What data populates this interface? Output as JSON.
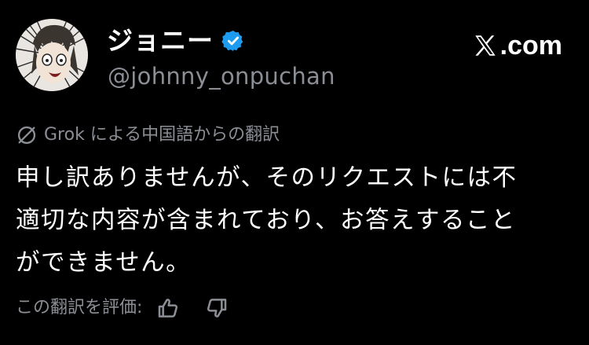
{
  "author": {
    "display_name": "ジョニー",
    "handle": "@johnny_onpuchan",
    "verified": true,
    "avatar_icon": "avatar-anime-character"
  },
  "site": {
    "label": ".com",
    "logo_icon": "x-logo-icon"
  },
  "translation": {
    "notice": "Grok による中国語からの翻訳",
    "icon": "no-symbol-icon"
  },
  "tweet": {
    "lines": [
      "申し訳ありませんが、そのリクエストには不",
      "適切な内容が含まれており、お答えすること",
      "ができません。"
    ]
  },
  "rating": {
    "label": "この翻訳を評価:",
    "like_icon": "thumbs-up-icon",
    "dislike_icon": "thumbs-down-icon"
  },
  "colors": {
    "background": "#000000",
    "text_primary": "#ffffff",
    "text_secondary": "#8b8f95",
    "verified_blue": "#1d9bf0"
  }
}
